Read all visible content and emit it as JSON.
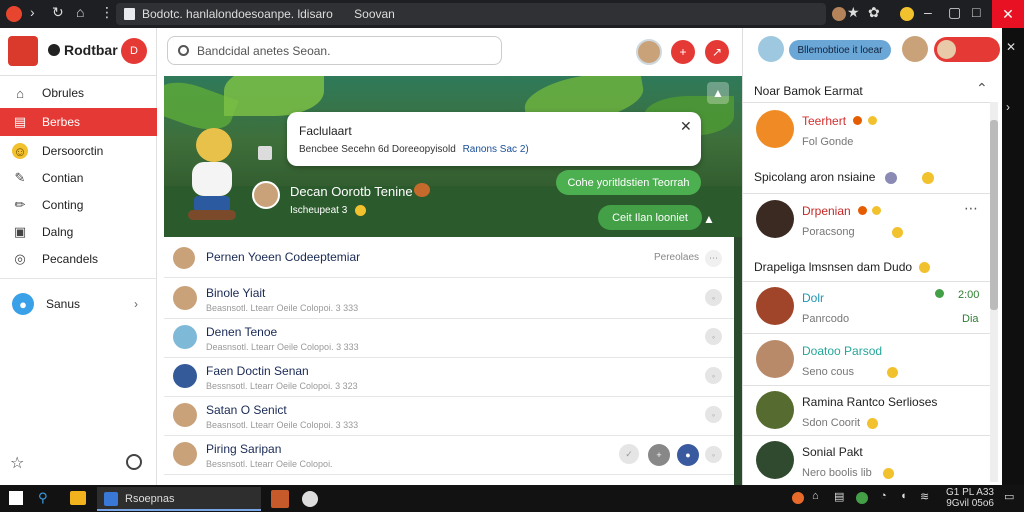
{
  "browser": {
    "address": "Bodotc. hanlalondoesoanpe. ldisaro",
    "address_tail": "Soovan"
  },
  "app": {
    "brand": "Rodtbar",
    "search_placeholder": "Bandcidal anetes Seoan."
  },
  "sidebar": {
    "items": [
      {
        "label": "Obrules",
        "icon": "home-icon"
      },
      {
        "label": "Berbes",
        "icon": "inbox-icon",
        "active": true
      },
      {
        "label": "Dersoorctin",
        "icon": "emoji-icon"
      },
      {
        "label": "Contian",
        "icon": "edit-box-icon"
      },
      {
        "label": "Conting",
        "icon": "pencil-icon"
      },
      {
        "label": "Dalng",
        "icon": "document-icon"
      },
      {
        "label": "Pecandels",
        "icon": "globe-icon"
      }
    ],
    "sanus": "Sanus"
  },
  "banner": {
    "popup_title": "Faclulaart",
    "popup_text": "Bencbee Secehn 6d Doreeopyisold",
    "popup_link": "Ranons Sac 2)",
    "profile_name": "Decan Oorotb Tenine",
    "profile_sub": "Ischeupeat 3",
    "btn1": "Cohe yoritldstien Teorrah",
    "btn2": "Ceit Ilan looniet"
  },
  "list": {
    "header_name": "Pernen Yoeen Codeeptemiar",
    "header_right": "Pereolaes",
    "rows": [
      {
        "name": "Binole Yiait",
        "sub": "Beasnsotl. Ltearr Oeile Colopoi. 3 333"
      },
      {
        "name": "Denen Tenoe",
        "sub": "Deasnsotl. Ltearr Oeile Colopoi. 3 333"
      },
      {
        "name": "Faen Doctin Senan",
        "sub": "Bessnsotl. Ltearr Oeile Colopoi. 3 323"
      },
      {
        "name": "Satan O Senict",
        "sub": "Beasnsotl. Ltearr Oeile Colopoi. 3 333"
      },
      {
        "name": "Piring Saripan",
        "sub": "Bessnsotl. Ltearr Oeile Colopoi."
      }
    ]
  },
  "right": {
    "pill": "Bllemobtioe it loear",
    "header": "Noar Bamok Earmat",
    "sect1": "Spicolang aron nsiaine",
    "sect2": "Drapeliga lmsnsen dam Dudo",
    "friends": [
      {
        "name": "Teerhert",
        "sub": "Fol Gonde"
      },
      {
        "name": "Drpenian",
        "sub": "Poracsong"
      },
      {
        "name": "Dolr",
        "sub": "Panrcodo",
        "time": "2:00",
        "tag": "Dia"
      },
      {
        "name": "Doatoo Parsod",
        "sub": "Seno cous"
      },
      {
        "name": "Ramina Rantco Serlioses",
        "sub": "Sdon Coorit"
      },
      {
        "name": "Sonial Pakt",
        "sub": "Nero boolis lib"
      }
    ]
  },
  "taskbar": {
    "app_label": "Rsoepnas",
    "time": "G1 PL A33",
    "date": "9Gvil 05o6"
  },
  "colors": {
    "accent": "#e53935",
    "green": "#4caf50",
    "link_blue": "#1a2a55"
  }
}
